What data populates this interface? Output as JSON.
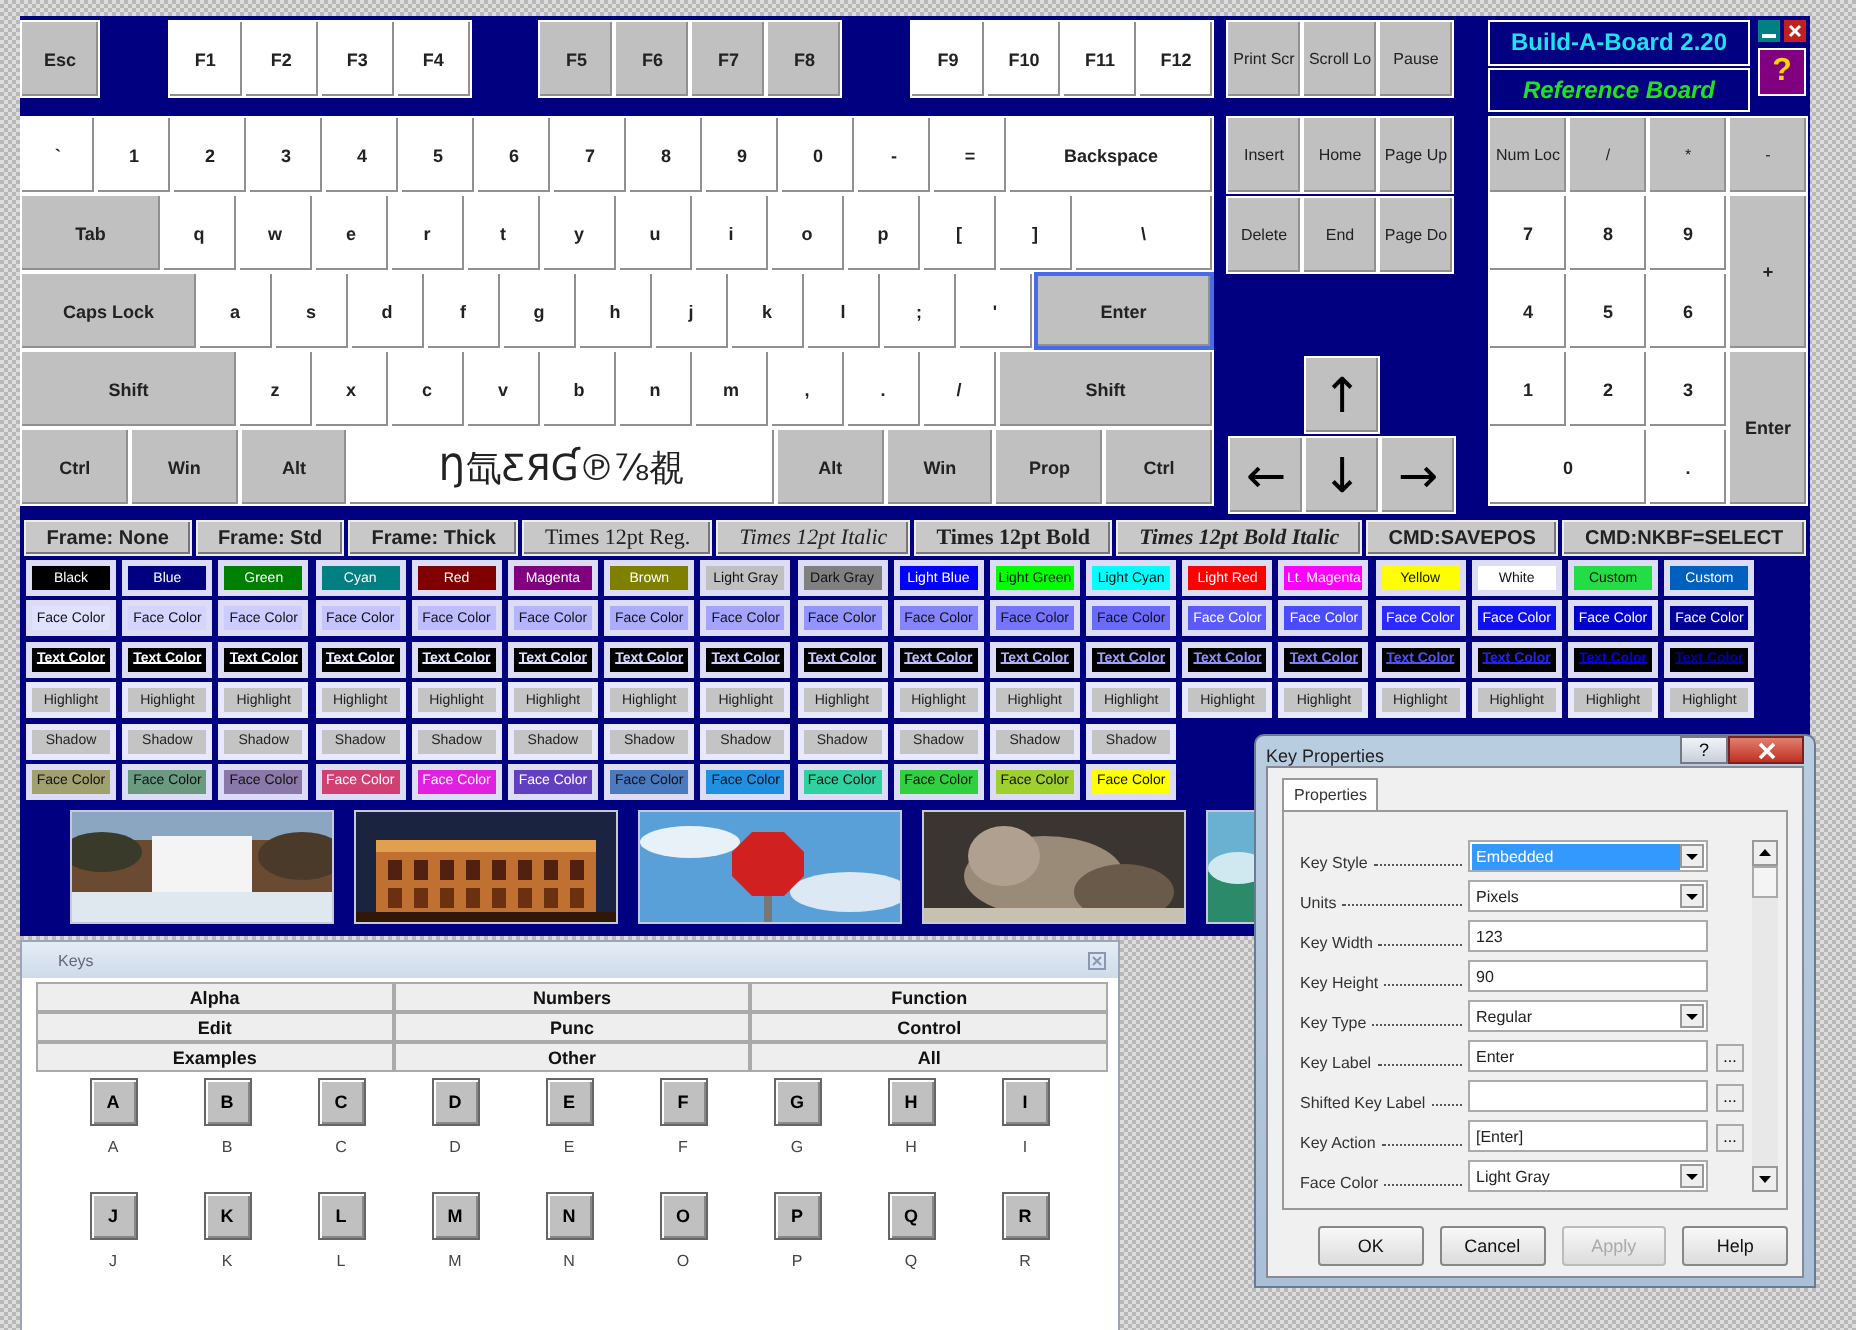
{
  "keyboard": {
    "function_row": [
      [
        {
          "label": "Esc",
          "kind": "mod",
          "selected": false
        }
      ],
      [
        {
          "label": "F1",
          "kind": "char",
          "selected": false
        },
        {
          "label": "F2",
          "kind": "char",
          "selected": false
        },
        {
          "label": "F3",
          "kind": "char",
          "selected": false
        },
        {
          "label": "F4",
          "kind": "char",
          "selected": false
        }
      ],
      [
        {
          "label": "F5",
          "kind": "mod",
          "selected": false
        },
        {
          "label": "F6",
          "kind": "mod",
          "selected": false
        },
        {
          "label": "F7",
          "kind": "mod",
          "selected": false
        },
        {
          "label": "F8",
          "kind": "mod",
          "selected": false
        }
      ],
      [
        {
          "label": "F9",
          "kind": "char",
          "selected": false
        },
        {
          "label": "F10",
          "kind": "char",
          "selected": false
        },
        {
          "label": "F11",
          "kind": "char",
          "selected": false
        },
        {
          "label": "F12",
          "kind": "char",
          "selected": false
        }
      ]
    ],
    "rows": [
      {
        "keys": [
          {
            "label": "`",
            "kind": "char",
            "selected": false
          },
          {
            "label": "1",
            "kind": "char",
            "selected": false
          },
          {
            "label": "2",
            "kind": "char",
            "selected": false
          },
          {
            "label": "3",
            "kind": "char",
            "selected": false
          },
          {
            "label": "4",
            "kind": "char",
            "selected": false
          },
          {
            "label": "5",
            "kind": "char",
            "selected": false
          },
          {
            "label": "6",
            "kind": "char",
            "selected": false
          },
          {
            "label": "7",
            "kind": "char",
            "selected": false
          },
          {
            "label": "8",
            "kind": "char",
            "selected": false
          },
          {
            "label": "9",
            "kind": "char",
            "selected": false
          },
          {
            "label": "0",
            "kind": "char",
            "selected": false
          },
          {
            "label": "-",
            "kind": "char",
            "selected": false
          },
          {
            "label": "=",
            "kind": "char",
            "selected": false
          },
          {
            "label": "Backspace",
            "kind": "wide",
            "selected": false
          }
        ]
      },
      {
        "keys": [
          {
            "label": "Tab",
            "kind": "mod",
            "selected": false
          },
          {
            "label": "q",
            "kind": "char",
            "selected": false
          },
          {
            "label": "w",
            "kind": "char",
            "selected": false
          },
          {
            "label": "e",
            "kind": "char",
            "selected": false
          },
          {
            "label": "r",
            "kind": "char",
            "selected": false
          },
          {
            "label": "t",
            "kind": "char",
            "selected": false
          },
          {
            "label": "y",
            "kind": "char",
            "selected": false
          },
          {
            "label": "u",
            "kind": "char",
            "selected": false
          },
          {
            "label": "i",
            "kind": "char",
            "selected": false
          },
          {
            "label": "o",
            "kind": "char",
            "selected": false
          },
          {
            "label": "p",
            "kind": "char",
            "selected": false
          },
          {
            "label": "[",
            "kind": "char",
            "selected": false
          },
          {
            "label": "]",
            "kind": "char",
            "selected": false
          },
          {
            "label": "\\",
            "kind": "wide",
            "selected": false
          }
        ]
      },
      {
        "keys": [
          {
            "label": "Caps Lock",
            "kind": "mod",
            "selected": false
          },
          {
            "label": "a",
            "kind": "char",
            "selected": false
          },
          {
            "label": "s",
            "kind": "char",
            "selected": false
          },
          {
            "label": "d",
            "kind": "char",
            "selected": false
          },
          {
            "label": "f",
            "kind": "char",
            "selected": false
          },
          {
            "label": "g",
            "kind": "char",
            "selected": false
          },
          {
            "label": "h",
            "kind": "char",
            "selected": false
          },
          {
            "label": "j",
            "kind": "char",
            "selected": false
          },
          {
            "label": "k",
            "kind": "char",
            "selected": false
          },
          {
            "label": "l",
            "kind": "char",
            "selected": false
          },
          {
            "label": ";",
            "kind": "char",
            "selected": false
          },
          {
            "label": "'",
            "kind": "char",
            "selected": false
          },
          {
            "label": "Enter",
            "kind": "mod",
            "selected": true
          }
        ]
      },
      {
        "keys": [
          {
            "label": "Shift",
            "kind": "mod",
            "selected": false
          },
          {
            "label": "z",
            "kind": "char",
            "selected": false
          },
          {
            "label": "x",
            "kind": "char",
            "selected": false
          },
          {
            "label": "c",
            "kind": "char",
            "selected": false
          },
          {
            "label": "v",
            "kind": "char",
            "selected": false
          },
          {
            "label": "b",
            "kind": "char",
            "selected": false
          },
          {
            "label": "n",
            "kind": "char",
            "selected": false
          },
          {
            "label": "m",
            "kind": "char",
            "selected": false
          },
          {
            "label": ",",
            "kind": "char",
            "selected": false
          },
          {
            "label": ".",
            "kind": "char",
            "selected": false
          },
          {
            "label": "/",
            "kind": "char",
            "selected": false
          },
          {
            "label": "Shift",
            "kind": "mod",
            "selected": false
          }
        ]
      },
      {
        "keys": [
          {
            "label": "Ctrl",
            "kind": "mod",
            "selected": false
          },
          {
            "label": "Win",
            "kind": "mod",
            "selected": false
          },
          {
            "label": "Alt",
            "kind": "mod",
            "selected": false
          },
          {
            "label": "Ŋ氙ƸЯƓ℗⅞覩",
            "kind": "space",
            "selected": false
          },
          {
            "label": "Alt",
            "kind": "mod",
            "selected": false
          },
          {
            "label": "Win",
            "kind": "mod",
            "selected": false
          },
          {
            "label": "Prop",
            "kind": "mod",
            "selected": false
          },
          {
            "label": "Ctrl",
            "kind": "mod",
            "selected": false
          }
        ]
      }
    ]
  },
  "system_keys": [
    {
      "label": "Print Scr",
      "kind": "mod",
      "selected": false
    },
    {
      "label": "Scroll Lo",
      "kind": "mod",
      "selected": false
    },
    {
      "label": "Pause",
      "kind": "mod",
      "selected": false
    }
  ],
  "nav_keys": [
    [
      {
        "label": "Insert",
        "kind": "mod",
        "selected": false
      },
      {
        "label": "Home",
        "kind": "mod",
        "selected": false
      },
      {
        "label": "Page Up",
        "kind": "mod",
        "selected": false
      }
    ],
    [
      {
        "label": "Delete",
        "kind": "mod",
        "selected": false
      },
      {
        "label": "End",
        "kind": "mod",
        "selected": false
      },
      {
        "label": "Page Do",
        "kind": "mod",
        "selected": false
      }
    ]
  ],
  "arrow_keys": [
    [
      {
        "label": "↑",
        "kind": "mod",
        "selected": false
      }
    ],
    [
      {
        "label": "←",
        "kind": "mod",
        "selected": false
      },
      {
        "label": "↓",
        "kind": "mod",
        "selected": false
      },
      {
        "label": "→",
        "kind": "mod",
        "selected": false
      }
    ]
  ],
  "numpad": [
    {
      "label": "Num Loc",
      "kind": "mod",
      "selected": false
    },
    {
      "label": "/",
      "kind": "mod",
      "selected": false
    },
    {
      "label": "*",
      "kind": "mod",
      "selected": false
    },
    {
      "label": "-",
      "kind": "mod",
      "selected": false
    },
    {
      "label": "7",
      "kind": "char",
      "selected": false
    },
    {
      "label": "8",
      "kind": "char",
      "selected": false
    },
    {
      "label": "9",
      "kind": "char",
      "selected": false
    },
    {
      "label": "+",
      "kind": "tall",
      "selected": false
    },
    {
      "label": "4",
      "kind": "char",
      "selected": false
    },
    {
      "label": "5",
      "kind": "char",
      "selected": false
    },
    {
      "label": "6",
      "kind": "char",
      "selected": false
    },
    {
      "label": "1",
      "kind": "char",
      "selected": false
    },
    {
      "label": "2",
      "kind": "char",
      "selected": false
    },
    {
      "label": "3",
      "kind": "char",
      "selected": false
    },
    {
      "label": "Enter",
      "kind": "tall",
      "selected": false
    },
    {
      "label": "0",
      "kind": "wide",
      "selected": false
    },
    {
      "label": ".",
      "kind": "char",
      "selected": false
    }
  ],
  "title": {
    "name": "Build-A-Board 2.20",
    "subtitle": "Reference Board"
  },
  "help_button": "?",
  "style_bar": [
    {
      "label": "Frame: None",
      "kind": "frame"
    },
    {
      "label": "Frame: Std",
      "kind": "frame"
    },
    {
      "label": "Frame: Thick",
      "kind": "frame"
    },
    {
      "label": "Times 12pt Reg.",
      "kind": "regular"
    },
    {
      "label": "Times 12pt Italic",
      "kind": "italic"
    },
    {
      "label": "Times 12pt Bold",
      "kind": "bold"
    },
    {
      "label": "Times 12pt Bold Italic",
      "kind": "bolditalic"
    },
    {
      "label": "CMD:SAVEPOS",
      "kind": "cmd"
    },
    {
      "label": "CMD:NKBF=SELECT",
      "kind": "cmd"
    }
  ],
  "swatch_rows": [
    {
      "kind": "fill",
      "items": [
        {
          "label": "Black",
          "color": "#000000"
        },
        {
          "label": "Blue",
          "color": "#000080"
        },
        {
          "label": "Green",
          "color": "#008000"
        },
        {
          "label": "Cyan",
          "color": "#008080"
        },
        {
          "label": "Red",
          "color": "#800000"
        },
        {
          "label": "Magenta",
          "color": "#800080"
        },
        {
          "label": "Brown",
          "color": "#808000"
        },
        {
          "label": "Light Gray",
          "color": "#c0c0c0"
        },
        {
          "label": "Dark Gray",
          "color": "#808080"
        },
        {
          "label": "Light Blue",
          "color": "#0000ff"
        },
        {
          "label": "Light Green",
          "color": "#00ff00"
        },
        {
          "label": "Light Cyan",
          "color": "#00ffff"
        },
        {
          "label": "Light Red",
          "color": "#ff0000"
        },
        {
          "label": "Lt. Magenta",
          "color": "#ff00ff"
        },
        {
          "label": "Yellow",
          "color": "#ffff00"
        },
        {
          "label": "White",
          "color": "#ffffff"
        },
        {
          "label": "Custom",
          "color": "#22dd44"
        },
        {
          "label": "Custom",
          "color": "#0060c0"
        }
      ]
    },
    {
      "kind": "fill",
      "items": [
        {
          "label": "Face Color",
          "color": "#e0e0ff"
        },
        {
          "label": "Face Color",
          "color": "#d4d4ff"
        },
        {
          "label": "Face Color",
          "color": "#ccccff"
        },
        {
          "label": "Face Color",
          "color": "#c4c4ff"
        },
        {
          "label": "Face Color",
          "color": "#bcbcff"
        },
        {
          "label": "Face Color",
          "color": "#b4b4ff"
        },
        {
          "label": "Face Color",
          "color": "#acacff"
        },
        {
          "label": "Face Color",
          "color": "#a4a4ff"
        },
        {
          "label": "Face Color",
          "color": "#9494ff"
        },
        {
          "label": "Face Color",
          "color": "#8484ff"
        },
        {
          "label": "Face Color",
          "color": "#7474ff"
        },
        {
          "label": "Face Color",
          "color": "#6a6aff"
        },
        {
          "label": "Face Color",
          "color": "#5a5aff"
        },
        {
          "label": "Face Color",
          "color": "#4a4aff"
        },
        {
          "label": "Face Color",
          "color": "#2a2aff"
        },
        {
          "label": "Face Color",
          "color": "#1010ee"
        },
        {
          "label": "Face Color",
          "color": "#0000cc"
        },
        {
          "label": "Face Color",
          "color": "#000099"
        }
      ]
    },
    {
      "kind": "text",
      "items": [
        {
          "label": "Text Color",
          "color": "#ffffff"
        },
        {
          "label": "Text Color",
          "color": "#ffffff"
        },
        {
          "label": "Text Color",
          "color": "#f4f4ff"
        },
        {
          "label": "Text Color",
          "color": "#eeeeff"
        },
        {
          "label": "Text Color",
          "color": "#e8e8ff"
        },
        {
          "label": "Text Color",
          "color": "#e0e0ff"
        },
        {
          "label": "Text Color",
          "color": "#d8d8ff"
        },
        {
          "label": "Text Color",
          "color": "#d0d0ff"
        },
        {
          "label": "Text Color",
          "color": "#c8c8ff"
        },
        {
          "label": "Text Color",
          "color": "#c0c0ff"
        },
        {
          "label": "Text Color",
          "color": "#b0b0ff"
        },
        {
          "label": "Text Color",
          "color": "#a0a0ff"
        },
        {
          "label": "Text Color",
          "color": "#9090ff"
        },
        {
          "label": "Text Color",
          "color": "#8080ff"
        },
        {
          "label": "Text Color",
          "color": "#5050ff"
        },
        {
          "label": "Text Color",
          "color": "#2020ff"
        },
        {
          "label": "Text Color",
          "color": "#0000ee"
        },
        {
          "label": "Text Color",
          "color": "#0000aa"
        }
      ]
    },
    {
      "kind": "plain",
      "items": [
        {
          "label": "Highlight"
        },
        {
          "label": "Highlight"
        },
        {
          "label": "Highlight"
        },
        {
          "label": "Highlight"
        },
        {
          "label": "Highlight"
        },
        {
          "label": "Highlight"
        },
        {
          "label": "Highlight"
        },
        {
          "label": "Highlight"
        },
        {
          "label": "Highlight"
        },
        {
          "label": "Highlight"
        },
        {
          "label": "Highlight"
        },
        {
          "label": "Highlight"
        },
        {
          "label": "Highlight"
        },
        {
          "label": "Highlight"
        },
        {
          "label": "Highlight"
        },
        {
          "label": "Highlight"
        },
        {
          "label": "Highlight"
        },
        {
          "label": "Highlight"
        }
      ]
    },
    {
      "kind": "plain",
      "items": [
        {
          "label": "Shadow"
        },
        {
          "label": "Shadow"
        },
        {
          "label": "Shadow"
        },
        {
          "label": "Shadow"
        },
        {
          "label": "Shadow"
        },
        {
          "label": "Shadow"
        },
        {
          "label": "Shadow"
        },
        {
          "label": "Shadow"
        },
        {
          "label": "Shadow"
        },
        {
          "label": "Shadow"
        },
        {
          "label": "Shadow"
        },
        {
          "label": "Shadow"
        }
      ]
    },
    {
      "kind": "fill",
      "items": [
        {
          "label": "Face Color",
          "color": "#a0a070"
        },
        {
          "label": "Face Color",
          "color": "#6a9a80"
        },
        {
          "label": "Face Color",
          "color": "#8a78a8"
        },
        {
          "label": "Face Color",
          "color": "#d04070"
        },
        {
          "label": "Face Color",
          "color": "#e020e0"
        },
        {
          "label": "Face Color",
          "color": "#6040c0"
        },
        {
          "label": "Face Color",
          "color": "#4a7ac0"
        },
        {
          "label": "Face Color",
          "color": "#2090e0"
        },
        {
          "label": "Face Color",
          "color": "#30d0a0"
        },
        {
          "label": "Face Color",
          "color": "#30d040"
        },
        {
          "label": "Face Color",
          "color": "#a0d030"
        },
        {
          "label": "Face Color",
          "color": "#ffff00"
        }
      ]
    }
  ],
  "pictures": [
    {
      "kind": "picture"
    },
    {
      "kind": "picture"
    },
    {
      "kind": "picture"
    },
    {
      "kind": "picture"
    },
    {
      "kind": "picture"
    }
  ],
  "keys_window": {
    "title": "Keys",
    "tabs": [
      {
        "label": "Alpha"
      },
      {
        "label": "Numbers"
      },
      {
        "label": "Function"
      },
      {
        "label": "Edit"
      },
      {
        "label": "Punc"
      },
      {
        "label": "Control"
      },
      {
        "label": "Examples"
      },
      {
        "label": "Other"
      },
      {
        "label": "All"
      }
    ],
    "keys": [
      {
        "key": "A",
        "caption": "A"
      },
      {
        "key": "B",
        "caption": "B"
      },
      {
        "key": "C",
        "caption": "C"
      },
      {
        "key": "D",
        "caption": "D"
      },
      {
        "key": "E",
        "caption": "E"
      },
      {
        "key": "F",
        "caption": "F"
      },
      {
        "key": "G",
        "caption": "G"
      },
      {
        "key": "H",
        "caption": "H"
      },
      {
        "key": "I",
        "caption": "I"
      },
      {
        "key": "J",
        "caption": "J"
      },
      {
        "key": "K",
        "caption": "K"
      },
      {
        "key": "L",
        "caption": "L"
      },
      {
        "key": "M",
        "caption": "M"
      },
      {
        "key": "N",
        "caption": "N"
      },
      {
        "key": "O",
        "caption": "O"
      },
      {
        "key": "P",
        "caption": "P"
      },
      {
        "key": "Q",
        "caption": "Q"
      },
      {
        "key": "R",
        "caption": "R"
      }
    ]
  },
  "dialog": {
    "title": "Key Properties",
    "help": "?",
    "tab": {
      "label": "Properties",
      "selected": true
    },
    "fields": [
      {
        "label": "Key Style",
        "kind": "dropdown",
        "value": "Embedded",
        "highlighted": true
      },
      {
        "label": "Units",
        "kind": "dropdown",
        "value": "Pixels",
        "highlighted": false
      },
      {
        "label": "Key Width",
        "kind": "text",
        "value": "123",
        "highlighted": false
      },
      {
        "label": "Key Height",
        "kind": "text",
        "value": "90",
        "highlighted": false
      },
      {
        "label": "Key Type",
        "kind": "dropdown",
        "value": "Regular",
        "highlighted": false
      },
      {
        "label": "Key Label",
        "kind": "browse",
        "value": "Enter",
        "button": "...",
        "highlighted": false
      },
      {
        "label": "Shifted Key Label",
        "kind": "browse",
        "button": "...",
        "highlighted": false
      },
      {
        "label": "Key Action",
        "kind": "browse",
        "value": "[Enter]",
        "button": "...",
        "highlighted": false
      },
      {
        "label": "Face Color",
        "kind": "dropdown",
        "value": "Light Gray",
        "highlighted": false
      }
    ],
    "buttons": [
      {
        "label": "OK",
        "disabled": false
      },
      {
        "label": "Cancel",
        "disabled": false
      },
      {
        "label": "Apply",
        "disabled": true
      },
      {
        "label": "Help",
        "disabled": false
      }
    ]
  }
}
